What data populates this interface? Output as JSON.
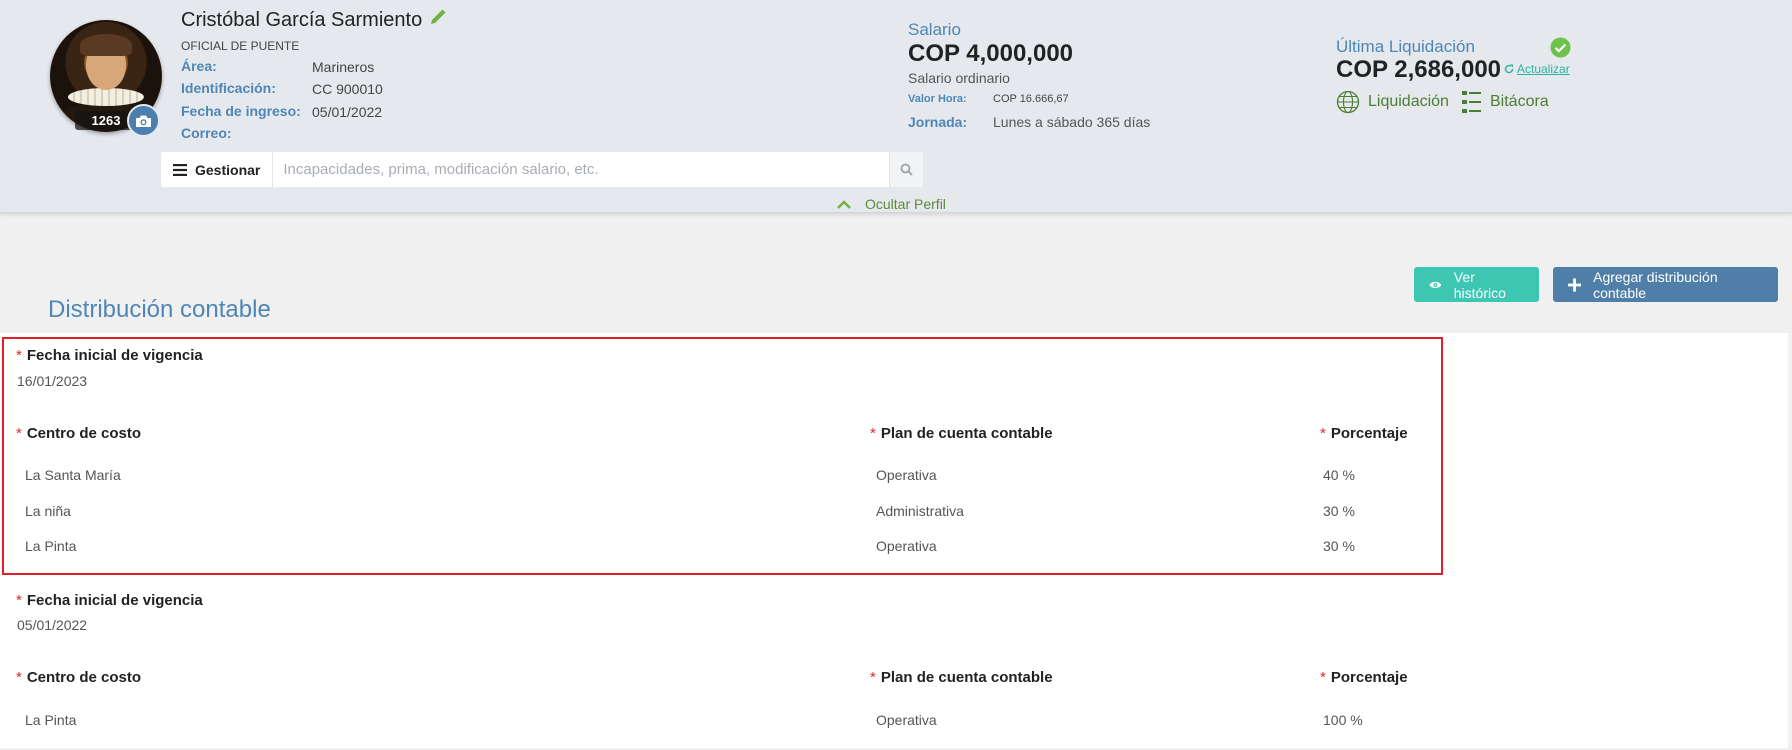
{
  "profile": {
    "name": "Cristóbal García Sarmiento",
    "position": "OFICIAL DE PUENTE",
    "employee_number": "1263",
    "fields": [
      {
        "label": "Área:",
        "value": "Marineros"
      },
      {
        "label": "Identificación:",
        "value": "CC 900010"
      },
      {
        "label": "Fecha de ingreso:",
        "value": "05/01/2022"
      },
      {
        "label": "Correo:",
        "value": ""
      }
    ]
  },
  "manage": {
    "button_label": "Gestionar",
    "placeholder": "Incapacidades, prima, modificación salario, etc."
  },
  "salary": {
    "title": "Salario",
    "amount": "COP 4,000,000",
    "type": "Salario ordinario",
    "hour_label": "Valor Hora:",
    "hour_value": "COP 16.666,67",
    "shift_label": "Jornada:",
    "shift_value": "Lunes a sábado 365 días"
  },
  "settlement": {
    "title": "Última Liquidación",
    "amount": "COP 2,686,000",
    "update_label": "Actualizar",
    "links": [
      {
        "label": "Liquidación",
        "icon": "globe-icon"
      },
      {
        "label": "Bitácora",
        "icon": "list-icon"
      }
    ]
  },
  "toggle_profile": "Ocultar Perfil",
  "section": {
    "title": "Distribución contable",
    "history_button": "Ver histórico",
    "add_button": "Agregar distribución contable"
  },
  "labels": {
    "start_date": "Fecha inicial de vigencia",
    "cost_center": "Centro de costo",
    "account_plan": "Plan de cuenta contable",
    "percentage": "Porcentaje"
  },
  "distributions": [
    {
      "start_date": "16/01/2023",
      "rows": [
        {
          "cost_center": "La Santa María",
          "account_plan": "Operativa",
          "percentage": "40 %"
        },
        {
          "cost_center": "La niña",
          "account_plan": "Administrativa",
          "percentage": "30 %"
        },
        {
          "cost_center": "La Pinta",
          "account_plan": "Operativa",
          "percentage": "30 %"
        }
      ]
    },
    {
      "start_date": "05/01/2022",
      "rows": [
        {
          "cost_center": "La Pinta",
          "account_plan": "Operativa",
          "percentage": "100 %"
        }
      ]
    }
  ],
  "colors": {
    "accent_blue": "#4f86b6",
    "green": "#5c8a3a",
    "teal_button": "#3dc6b2",
    "blue_button": "#4f7fa8",
    "highlight": "#e01f26",
    "required": "#e02727"
  }
}
